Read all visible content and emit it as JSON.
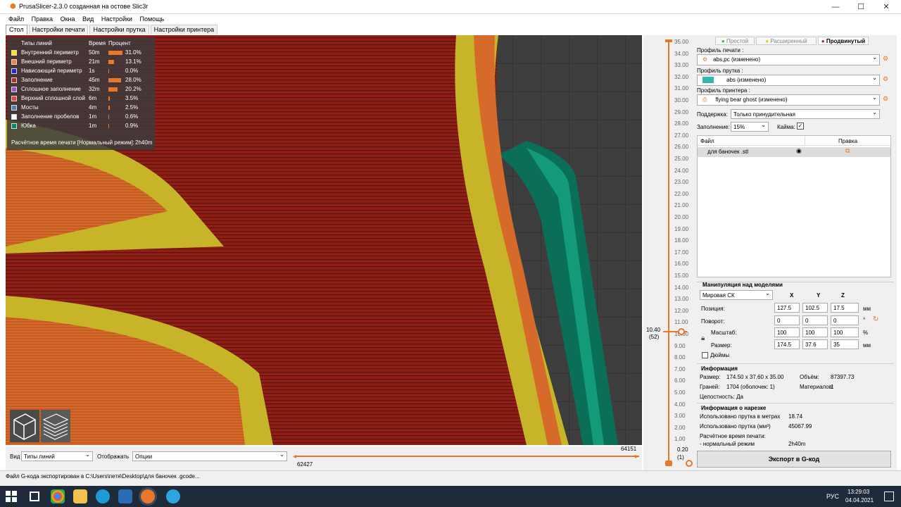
{
  "window": {
    "title": "PrusaSlicer-2.3.0 созданная на остове Slic3r",
    "minimize": "—",
    "maximize": "☐",
    "close": "✕"
  },
  "menu": [
    "Файл",
    "Правка",
    "Окна",
    "Вид",
    "Настройки",
    "Помощь"
  ],
  "tabs": [
    "Стол",
    "Настройки печати",
    "Настройки прутка",
    "Настройки принтера"
  ],
  "legend": {
    "headers": {
      "type": "Типы линий",
      "time": "Время",
      "percent": "Процент"
    },
    "rows": [
      {
        "name": "Внутренний периметр",
        "time": "50m",
        "percent": "31.0%",
        "fraction": 0.31,
        "color": "#ffe600"
      },
      {
        "name": "Внешний периметр",
        "time": "21m",
        "percent": "13.1%",
        "fraction": 0.131,
        "color": "#ff7d38"
      },
      {
        "name": "Нависающий периметр",
        "time": "1s",
        "percent": "0.0%",
        "fraction": 0.0,
        "color": "#1f1fff"
      },
      {
        "name": "Заполнение",
        "time": "45m",
        "percent": "28.0%",
        "fraction": 0.28,
        "color": "#b03029"
      },
      {
        "name": "Сплошное заполнение",
        "time": "32m",
        "percent": "20.2%",
        "fraction": 0.202,
        "color": "#9654cc"
      },
      {
        "name": "Верхний сплошной слой",
        "time": "6m",
        "percent": "3.5%",
        "fraction": 0.035,
        "color": "#f04040"
      },
      {
        "name": "Мосты",
        "time": "4m",
        "percent": "2.5%",
        "fraction": 0.025,
        "color": "#4d80ba"
      },
      {
        "name": "Заполнение пробелов",
        "time": "1m",
        "percent": "0.6%",
        "fraction": 0.006,
        "color": "#ffffff"
      },
      {
        "name": "Юбка",
        "time": "1m",
        "percent": "0.9%",
        "fraction": 0.009,
        "color": "#00876e"
      }
    ],
    "estimate_label": "Расчётное время печати [Нормальный режим]:",
    "estimate_value": "2h40m"
  },
  "bottom": {
    "view_label": "Вид",
    "view_value": "Типы линий",
    "show_label": "Отображать",
    "show_value": "Опции",
    "hslider_left": "62427",
    "hslider_right": "64151"
  },
  "vslider": {
    "ticks": [
      "35.00",
      "34.00",
      "33.00",
      "32.00",
      "31.00",
      "30.00",
      "29.00",
      "28.00",
      "27.00",
      "26.00",
      "25.00",
      "24.00",
      "23.00",
      "22.00",
      "21.00",
      "20.00",
      "19.00",
      "18.00",
      "17.00",
      "16.00",
      "15.00",
      "14.00",
      "13.00",
      "12.00",
      "11.00",
      "10.00",
      "9.00",
      "8.00",
      "7.00",
      "6.00",
      "5.00",
      "4.00",
      "3.00",
      "2.00",
      "1.00"
    ],
    "current_value": "10.40",
    "current_layer": "(52)",
    "bottom_value": "0.20",
    "bottom_layer": "(1)"
  },
  "right": {
    "modes": {
      "simple": "Простой",
      "advanced": "Расширенный",
      "expert": "Продвинутый"
    },
    "print_profile_label": "Профиль печати :",
    "print_profile": "abs,pc (изменено)",
    "filament_label": "Профиль прутка :",
    "filament": "abs (изменено)",
    "filament_color": "#2fb7b0",
    "printer_label": "Профиль принтера :",
    "printer": "flying bear ghost (изменено)",
    "support_label": "Поддержка:",
    "support": "Только принудительная",
    "infill_label": "Заполнение:",
    "infill": "15%",
    "brim_label": "Кайма:",
    "table": {
      "col_file": "Файл",
      "col_edit": "Правка",
      "row": "для баночек .stl"
    },
    "manip": {
      "title": "Манипуляция над моделями",
      "cs": "Мировая СК",
      "x": "X",
      "y": "Y",
      "z": "Z",
      "pos_label": "Позиция:",
      "pos": [
        "127.5",
        "102.5",
        "17.5"
      ],
      "pos_unit": "мм",
      "rot_label": "Поворот:",
      "rot": [
        "0",
        "0",
        "0"
      ],
      "rot_unit": "°",
      "scale_label": "Масштаб:",
      "scale": [
        "100",
        "100",
        "100"
      ],
      "scale_unit": "%",
      "size_label": "Размер:",
      "size": [
        "174.5",
        "37.6",
        "35"
      ],
      "size_unit": "мм",
      "inches": "Дюймы"
    },
    "info": {
      "title": "Информация",
      "size_label": "Размер:",
      "size": "174.50 x 37.60 x 35.00",
      "volume_label": "Объём:",
      "volume": "87397.73",
      "facets_label": "Граней:",
      "facets": "1704 (оболочек: 1)",
      "materials_label": "Материалов:",
      "materials": "1",
      "integrity": "Целостность: Да"
    },
    "slice": {
      "title": "Информация о нарезке",
      "meters_label": "Использовано прутка в метрах",
      "meters": "18.74",
      "mm3_label": "Использовано прутка (мм³)",
      "mm3": "45067.99",
      "time_label": "Расчётное время печати:",
      "mode_label": "- нормальный режим",
      "time": "2h40m"
    },
    "export": "Экспорт в G-код"
  },
  "status": "Файл G-кода экспортирован в C:\\Users\\петя\\Desktop\\для баночек .gcode...",
  "taskbar": {
    "lang": "РУС",
    "time": "13:29:03",
    "date": "04.04.2021"
  }
}
